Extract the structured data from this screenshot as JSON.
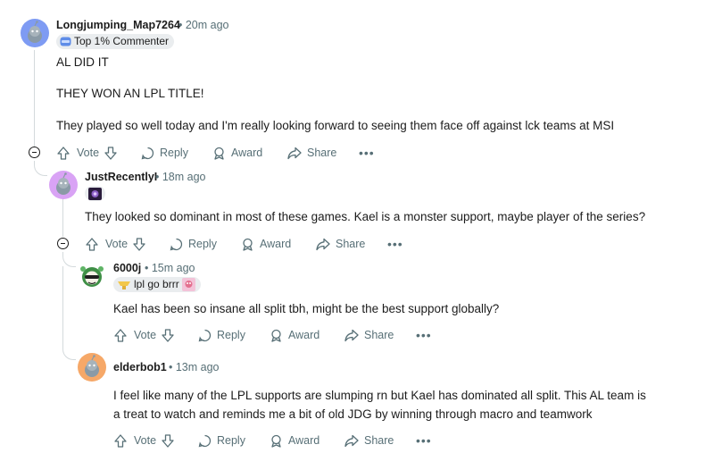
{
  "comments": [
    {
      "username": "Longjumping_Map7264",
      "time": "• 20m ago",
      "flair": "Top 1% Commenter",
      "body": [
        "AL DID IT",
        "THEY WON AN LPL TITLE!",
        "They played so well today and I'm really looking forward to seeing them face off against lck teams at MSI"
      ]
    },
    {
      "username": "JustRecentlyI",
      "time": "• 18m ago",
      "body": [
        "They looked so dominant in most of these games. Kael is a monster support, maybe player of the series?"
      ]
    },
    {
      "username": "6000j",
      "time": "• 15m ago",
      "flair": "lpl go brrr",
      "body": [
        "Kael has been so insane all split tbh, might be the best support globally?"
      ]
    },
    {
      "username": "elderbob1",
      "time": "• 13m ago",
      "body": [
        "I feel like many of the LPL supports are slumping rn but Kael has dominated all split. This AL team is",
        "a treat to watch and reminds me a bit of old JDG by winning through macro and teamwork"
      ]
    }
  ],
  "actions": {
    "vote": "Vote",
    "reply": "Reply",
    "award": "Award",
    "share": "Share",
    "more": "•••"
  },
  "colors": {
    "avatar_1": "#7e9bf3",
    "avatar_2": "#d9a3f5",
    "avatar_4": "#f6a868",
    "muted": "#576f76",
    "thread": "#d4dadc"
  }
}
